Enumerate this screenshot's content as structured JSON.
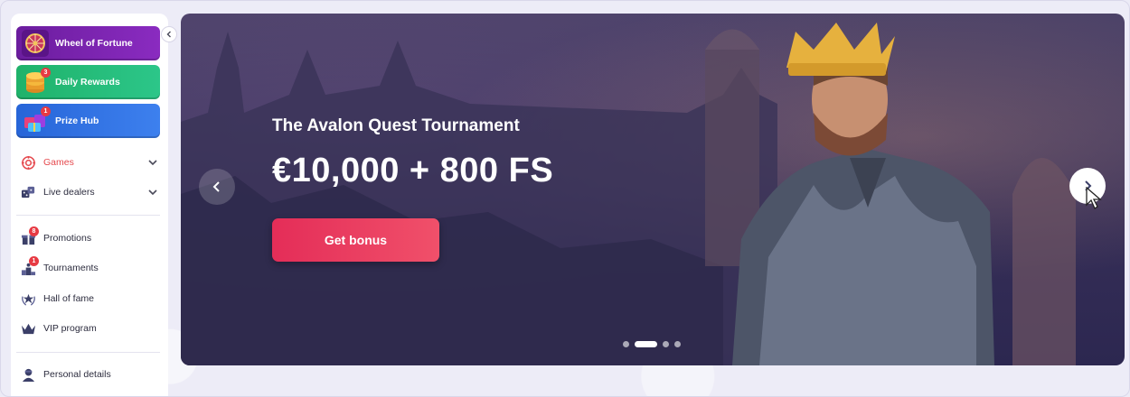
{
  "sidebar": {
    "promo_cards": [
      {
        "label": "Wheel of Fortune",
        "icon": "wheel-icon",
        "badge": ""
      },
      {
        "label": "Daily Rewards",
        "icon": "coins-stack-icon",
        "badge": "3"
      },
      {
        "label": "Prize Hub",
        "icon": "gift-boxes-icon",
        "badge": "1"
      }
    ],
    "nav": [
      {
        "label": "Games",
        "icon": "games-icon",
        "active": true
      },
      {
        "label": "Live dealers",
        "icon": "dice-icon",
        "active": false
      }
    ],
    "menu": [
      {
        "label": "Promotions",
        "icon": "gift-icon",
        "badge": "8"
      },
      {
        "label": "Tournaments",
        "icon": "podium-icon",
        "badge": "1"
      },
      {
        "label": "Hall of fame",
        "icon": "laurel-icon",
        "badge": ""
      },
      {
        "label": "VIP program",
        "icon": "crown-icon",
        "badge": ""
      }
    ],
    "account": [
      {
        "label": "Personal details",
        "icon": "user-icon"
      }
    ]
  },
  "banner": {
    "title": "The Avalon Quest Tournament",
    "amount": "€10,000 + 800 FS",
    "cta": "Get bonus",
    "slides_total": 4,
    "active_slide": 2
  },
  "colors": {
    "accent_red": "#e42d58",
    "games_active": "#e5484d",
    "wheel_card": "#7a24b0",
    "daily_card": "#25bc79",
    "prize_card": "#3373e4"
  }
}
